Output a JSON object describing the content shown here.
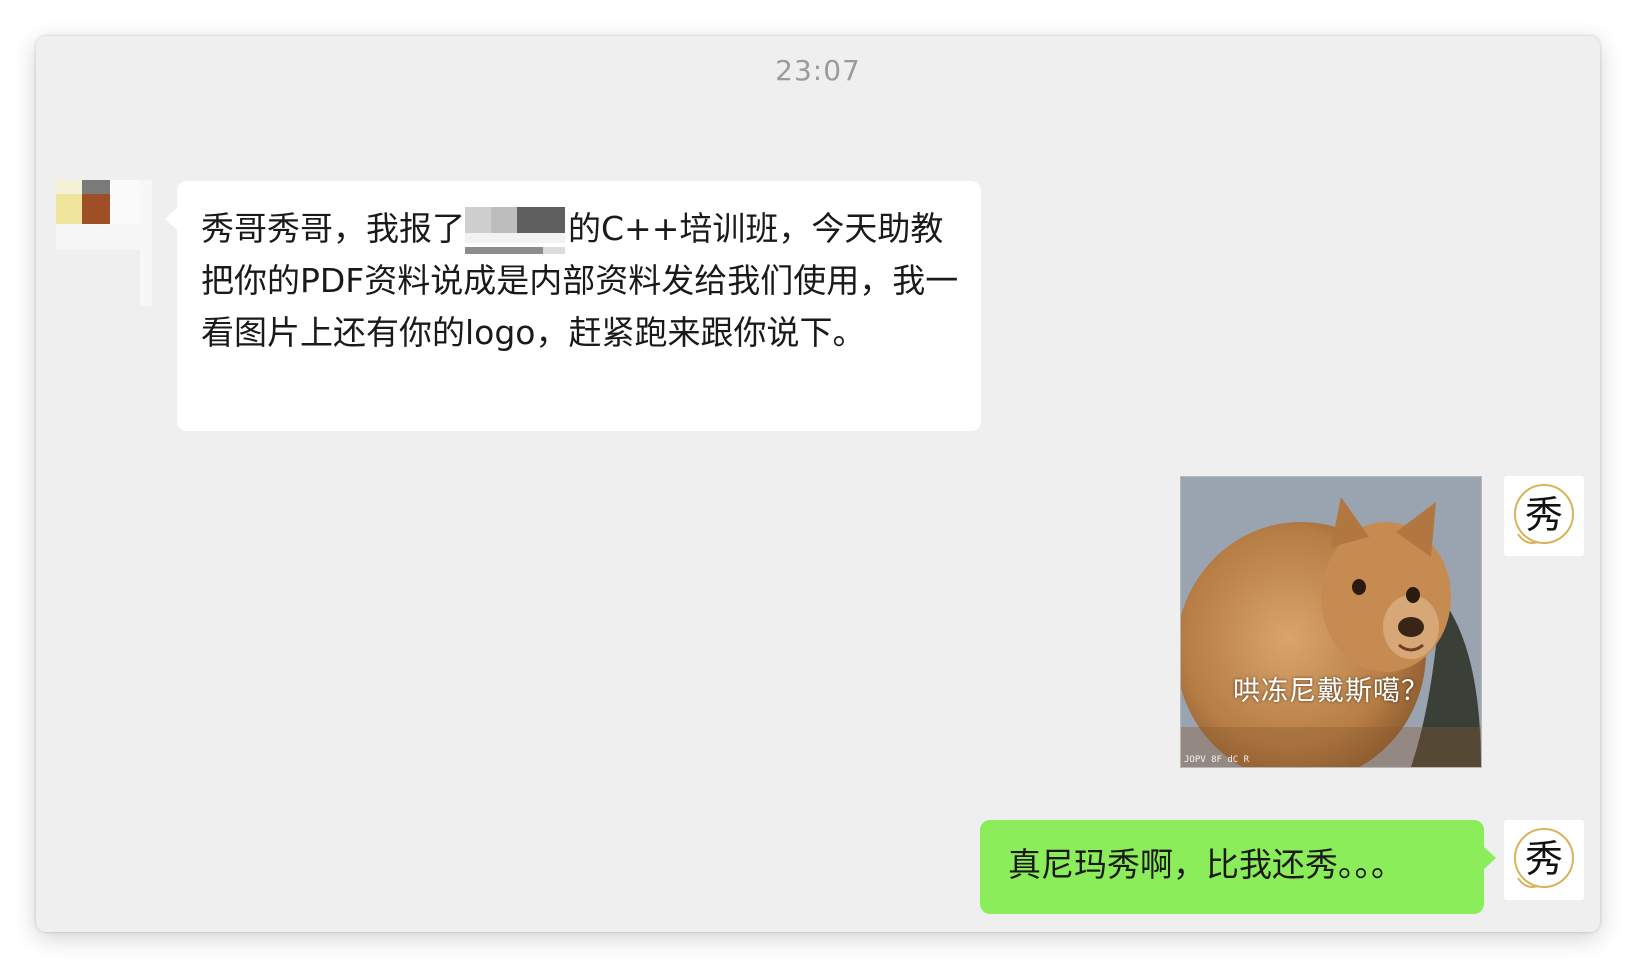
{
  "chat": {
    "timestamp": "23:07",
    "incoming": {
      "text_before": "秀哥秀哥，我报了",
      "text_after": "的C++培训班，今天助教把你的PDF资料说成是内部资料发给我们使用，我一看图片上还有你的logo，赶紧跑来跟你说下。"
    },
    "sticker": {
      "caption": "哄冻尼戴斯噶？",
      "watermark": "JOPV 8F dC R"
    },
    "outgoing": {
      "text": "真尼玛秀啊，比我还秀。。。"
    },
    "avatar_glyph": "秀",
    "colors": {
      "window_bg": "#efefef",
      "incoming_bubble": "#ffffff",
      "outgoing_bubble": "#8ced5a",
      "timestamp": "#9b9b9b"
    }
  }
}
